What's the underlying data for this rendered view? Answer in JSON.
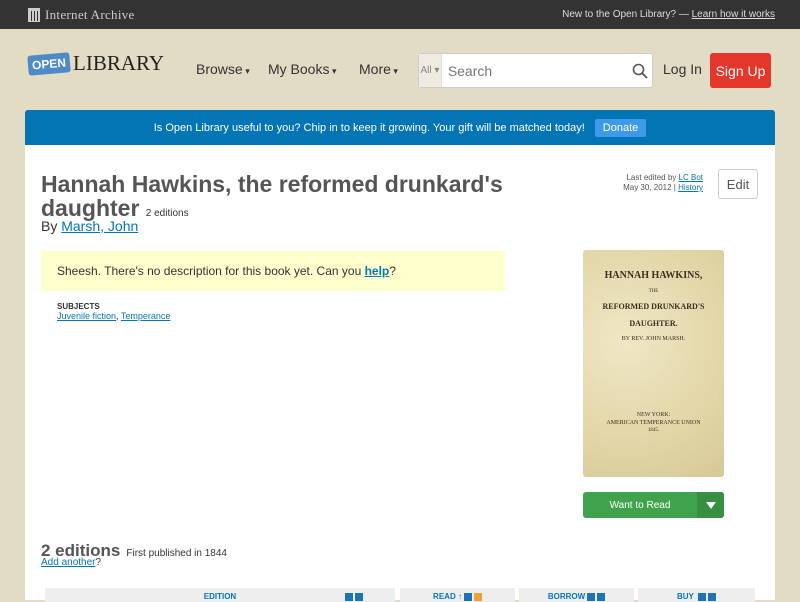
{
  "topbar": {
    "brand": "Internet Archive",
    "new_text": "New to the Open Library? —",
    "learn_link": "Learn how it works"
  },
  "header": {
    "logo_open": "OPEN",
    "logo_library": "LIBRARY",
    "nav": [
      "Browse",
      "My Books",
      "More"
    ],
    "search_scope": "All ▾",
    "search_placeholder": "Search",
    "login": "Log In",
    "signup": "Sign Up"
  },
  "banner": {
    "text": "Is Open Library useful to you? Chip in to keep it growing. Your gift will be matched today!",
    "donate": "Donate"
  },
  "book": {
    "title": "Hannah Hawkins, the reformed drunkard's daughter",
    "editions_count": "2 editions",
    "by": "By",
    "author": "Marsh, John",
    "last_edited_prefix": "Last edited by",
    "last_edited_by": "LC Bot",
    "last_edited_date": "May 30, 2012 |",
    "history": "History",
    "edit": "Edit",
    "desc_text": "Sheesh. There's no description for this book yet. Can you",
    "desc_link": "help",
    "desc_end": "?",
    "subjects_label": "SUBJECTS",
    "subjects": [
      "Juvenile fiction",
      "Temperance"
    ],
    "cover_lines": [
      "HANNAH HAWKINS,",
      "THE",
      "REFORMED DRUNKARD'S",
      "DAUGHTER.",
      "BY REV. JOHN MARSH.",
      "NEW YORK:",
      "AMERICAN TEMPERANCE UNION",
      "1845."
    ],
    "want_to_read": "Want to Read"
  },
  "editions": {
    "heading": "2 editions",
    "first_published": "First published in 1844",
    "add_another": "Add another",
    "q": "?",
    "columns": [
      "EDITION",
      "READ ↑",
      "BORROW",
      "BUY"
    ]
  }
}
